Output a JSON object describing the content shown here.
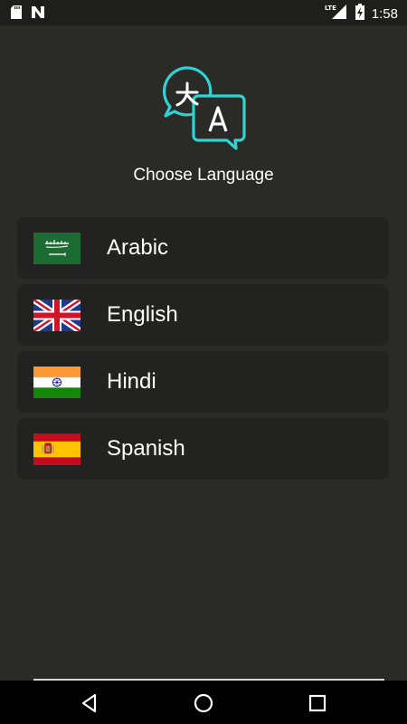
{
  "status_bar": {
    "time": "1:58",
    "network": "LTE",
    "icons": [
      "sd-card-icon",
      "n-notification-icon",
      "lte-signal-icon",
      "battery-charging-icon"
    ]
  },
  "header": {
    "icon": "translate-bubbles-icon",
    "title": "Choose Language",
    "accent_color": "#2fd3d3"
  },
  "languages": [
    {
      "label": "Arabic",
      "flag": "saudi-arabia-flag-icon"
    },
    {
      "label": "English",
      "flag": "uk-flag-icon"
    },
    {
      "label": "Hindi",
      "flag": "india-flag-icon"
    },
    {
      "label": "Spanish",
      "flag": "spain-flag-icon"
    }
  ],
  "nav_bar": {
    "icons": [
      "back-icon",
      "home-icon",
      "recents-icon"
    ]
  },
  "colors": {
    "background": "#2a2a27",
    "card": "#222221",
    "text": "#ffffff"
  }
}
